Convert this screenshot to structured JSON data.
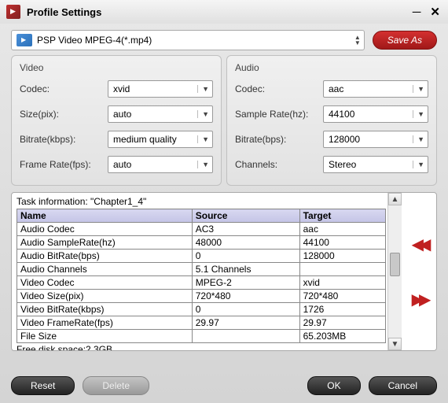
{
  "window": {
    "title": "Profile Settings"
  },
  "profile": {
    "name": "PSP Video MPEG-4(*.mp4)"
  },
  "buttons": {
    "save_as": "Save As",
    "reset": "Reset",
    "delete": "Delete",
    "ok": "OK",
    "cancel": "Cancel"
  },
  "video": {
    "title": "Video",
    "codec_label": "Codec:",
    "codec_value": "xvid",
    "size_label": "Size(pix):",
    "size_value": "auto",
    "bitrate_label": "Bitrate(kbps):",
    "bitrate_value": "medium quality",
    "fps_label": "Frame Rate(fps):",
    "fps_value": "auto"
  },
  "audio": {
    "title": "Audio",
    "codec_label": "Codec:",
    "codec_value": "aac",
    "sr_label": "Sample Rate(hz):",
    "sr_value": "44100",
    "bitrate_label": "Bitrate(bps):",
    "bitrate_value": "128000",
    "channels_label": "Channels:",
    "channels_value": "Stereo"
  },
  "task": {
    "header": "Task information: \"Chapter1_4\"",
    "columns": [
      "Name",
      "Source",
      "Target"
    ],
    "rows": [
      {
        "name": "Audio Codec",
        "source": "AC3",
        "target": "aac"
      },
      {
        "name": "Audio SampleRate(hz)",
        "source": "48000",
        "target": "44100"
      },
      {
        "name": "Audio BitRate(bps)",
        "source": "0",
        "target": "128000"
      },
      {
        "name": "Audio Channels",
        "source": "5.1 Channels",
        "target": ""
      },
      {
        "name": "Video Codec",
        "source": "MPEG-2",
        "target": "xvid"
      },
      {
        "name": "Video Size(pix)",
        "source": "720*480",
        "target": "720*480"
      },
      {
        "name": "Video BitRate(kbps)",
        "source": "0",
        "target": "1726"
      },
      {
        "name": "Video FrameRate(fps)",
        "source": "29.97",
        "target": "29.97"
      },
      {
        "name": "File Size",
        "source": "",
        "target": "65.203MB"
      }
    ],
    "free_disk": "Free disk space:2.3GB"
  }
}
